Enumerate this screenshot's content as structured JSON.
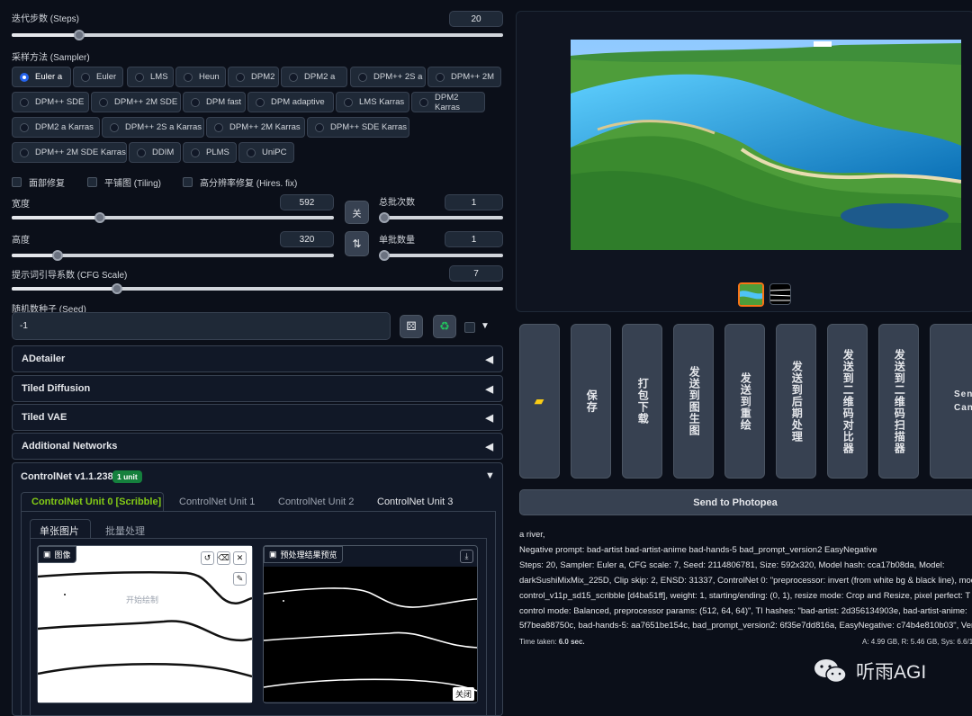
{
  "steps": {
    "label": "迭代步数 (Steps)",
    "value": "20",
    "fraction": 0.13
  },
  "sampler": {
    "label": "采样方法 (Sampler)",
    "selected": "Euler a",
    "options": [
      "Euler a",
      "Euler",
      "LMS",
      "Heun",
      "DPM2",
      "DPM2 a",
      "DPM++ 2S a",
      "DPM++ 2M",
      "DPM++ SDE",
      "DPM++ 2M SDE",
      "DPM fast",
      "DPM adaptive",
      "LMS Karras",
      "DPM2 Karras",
      "DPM2 a Karras",
      "DPM++ 2S a Karras",
      "DPM++ 2M Karras",
      "DPM++ SDE Karras",
      "DPM++ 2M SDE Karras",
      "DDIM",
      "PLMS",
      "UniPC"
    ]
  },
  "checks": {
    "restore_faces": "面部修复",
    "tiling": "平铺图 (Tiling)",
    "hires": "高分辨率修复 (Hires. fix)"
  },
  "width": {
    "label": "宽度",
    "value": "592"
  },
  "height": {
    "label": "高度",
    "value": "320"
  },
  "batch_count": {
    "label": "总批次数",
    "value": "1"
  },
  "batch_size": {
    "label": "单批数量",
    "value": "1"
  },
  "swap_icon": "关",
  "cfg": {
    "label": "提示词引导系数 (CFG Scale)",
    "value": "7"
  },
  "seed": {
    "label": "随机数种子 (Seed)",
    "value": "-1"
  },
  "accordions": [
    "ADetailer",
    "Tiled Diffusion",
    "Tiled VAE",
    "Additional Networks"
  ],
  "controlnet": {
    "title": "ControlNet v1.1.238",
    "badge": "1 unit",
    "units": [
      "ControlNet Unit 0 [Scribble]",
      "ControlNet Unit 1",
      "ControlNet Unit 2",
      "ControlNet Unit 3"
    ],
    "subtabs": [
      "单张图片",
      "批量处理"
    ],
    "image_label": "图像",
    "canvas_hint": "开始绘制",
    "preview_label": "预处理结果预览",
    "close_label": "关闭"
  },
  "actions": {
    "save": "保存",
    "zip": "打包下载",
    "to_img2img": "发送到图生图",
    "to_inpaint": "发送到重绘",
    "to_extras": "发送到后期处理",
    "to_qr_compare": "发送到二维码对比器",
    "to_qr_scan": "发送到二维码扫描器",
    "canvas_a": "Send",
    "canvas_b": "Canvas",
    "photopea": "Send to Photopea"
  },
  "output": {
    "line1": "a river,",
    "line2": "Negative prompt: bad-artist bad-artist-anime bad-hands-5 bad_prompt_version2 EasyNegative",
    "line3": "Steps: 20, Sampler: Euler a, CFG scale: 7, Seed: 2114806781, Size: 592x320, Model hash: cca17b08da, Model:",
    "line4": "darkSushiMixMix_225D, Clip skip: 2, ENSD: 31337, ControlNet 0: \"preprocessor: invert (from white bg & black line), mod",
    "line5": "control_v11p_sd15_scribble [d4ba51ff], weight: 1, starting/ending: (0, 1), resize mode: Crop and Resize, pixel perfect: T",
    "line6": "control mode: Balanced, preprocessor params: (512, 64, 64)\", TI hashes: \"bad-artist: 2d356134903e, bad-artist-anime:",
    "line7": "5f7bea88750c, bad-hands-5: aa7651be154c, bad_prompt_version2: 6f35e7dd816a, EasyNegative: c74b4e810b03\", Vers",
    "time_label": "Time taken:",
    "time_value": "6.0 sec.",
    "mem": "A: 4.99 GB, R: 5.46 GB, Sys: 6.6/12"
  },
  "watermark": "听雨AGI"
}
